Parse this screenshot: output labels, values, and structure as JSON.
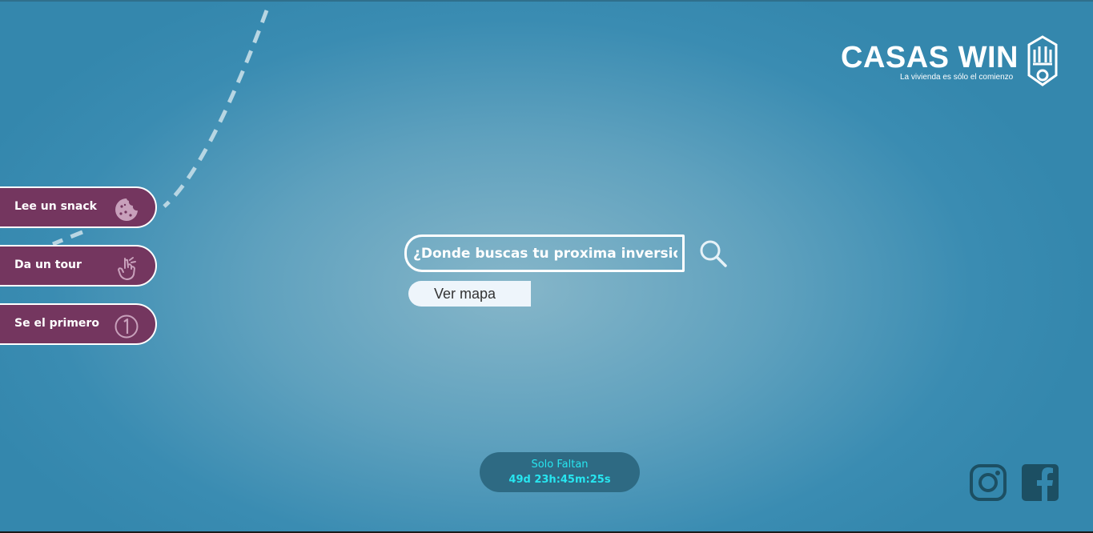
{
  "brand": {
    "name": "CASAS WIN",
    "tagline": "La vivienda es sólo el comienzo"
  },
  "side_menu": [
    {
      "label": "Lee un snack",
      "icon": "cookie-icon"
    },
    {
      "label": "Da un tour",
      "icon": "hand-pointer-icon"
    },
    {
      "label": "Se el primero",
      "icon": "number-one-icon"
    }
  ],
  "search": {
    "placeholder": "¿Donde buscas tu proxima inversion?",
    "icon": "search-icon"
  },
  "map_button": {
    "label": "Ver mapa"
  },
  "countdown": {
    "label": "Solo Faltan",
    "value": "49d 23h:45m:25s"
  },
  "social": [
    {
      "name": "instagram-icon"
    },
    {
      "name": "facebook-icon"
    }
  ],
  "colors": {
    "pill_bg": "#74365f",
    "countdown_bg": "#2e6a83",
    "countdown_text": "#27e6f0",
    "social_icon": "#1c4f63"
  }
}
